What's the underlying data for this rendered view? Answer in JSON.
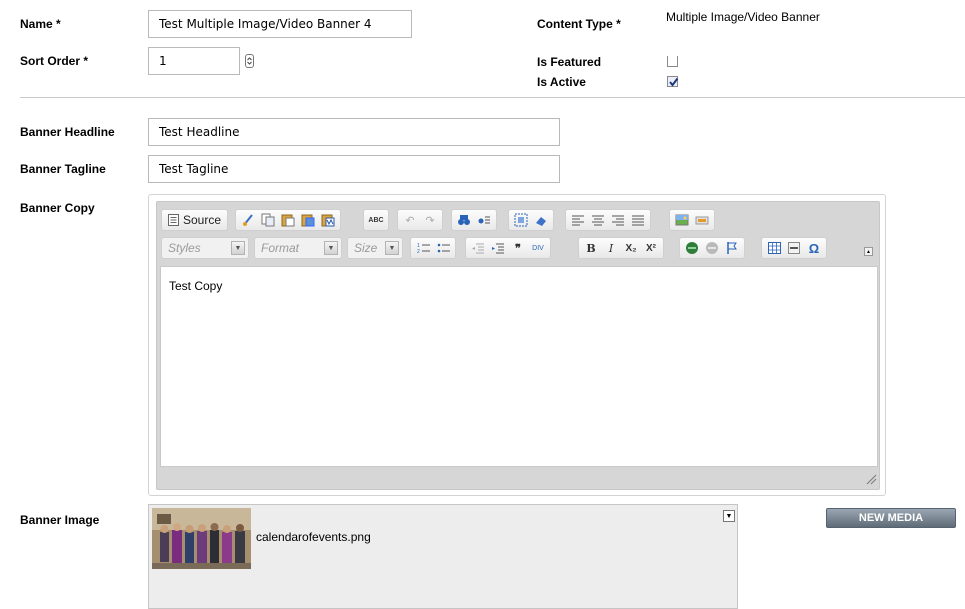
{
  "form": {
    "name_label": "Name *",
    "name_value": "Test Multiple Image/Video Banner 4",
    "content_type_label": "Content Type *",
    "content_type_value": "Multiple Image/Video Banner",
    "sort_order_label": "Sort Order *",
    "sort_order_value": "1",
    "is_featured_label": "Is Featured",
    "is_featured_checked": false,
    "is_active_label": "Is Active",
    "is_active_checked": true,
    "banner_headline_label": "Banner Headline",
    "banner_headline_value": "Test Headline",
    "banner_tagline_label": "Banner Tagline",
    "banner_tagline_value": "Test Tagline",
    "banner_copy_label": "Banner Copy",
    "banner_copy_value": "Test Copy",
    "banner_image_label": "Banner Image",
    "banner_image_filename": "calendarofevents.png",
    "new_media_label": "NEW MEDIA"
  },
  "editor": {
    "source_label": "Source",
    "styles_placeholder": "Styles",
    "format_placeholder": "Format",
    "size_placeholder": "Size",
    "bold_glyph": "B",
    "italic_glyph": "I",
    "subscript_glyph": "X₂",
    "superscript_glyph": "X²",
    "omega_glyph": "Ω",
    "spellcheck_glyph": "ABC"
  }
}
